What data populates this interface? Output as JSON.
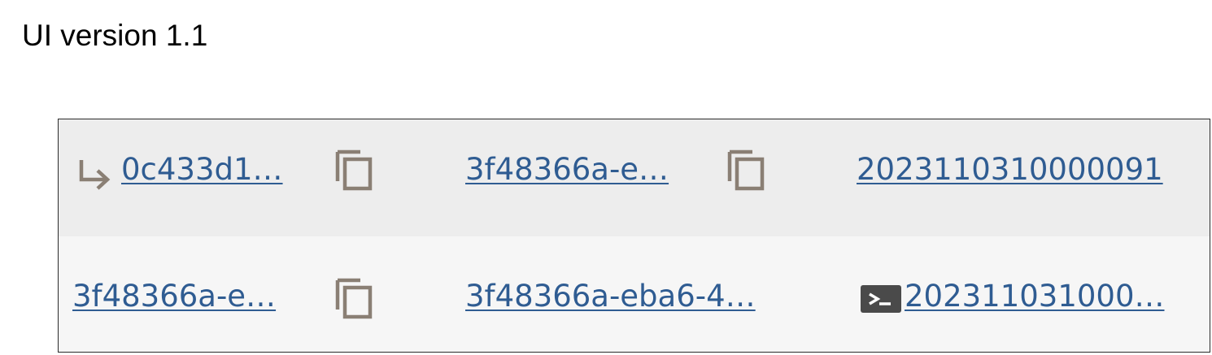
{
  "caption": "UI version 1.1",
  "rows": [
    {
      "col1": {
        "icon": "return-arrow-icon",
        "text": "0c433d1…",
        "copy_icon": "copy-icon"
      },
      "col2": {
        "text": "3f48366a-e…",
        "copy_icon": "copy-icon"
      },
      "col3": {
        "text": "2023110310000091"
      }
    },
    {
      "col1": {
        "text": "3f48366a-e…",
        "copy_icon": "copy-icon"
      },
      "col2": {
        "text": "3f48366a-eba6-4…"
      },
      "col3": {
        "icon": "terminal-icon",
        "text": "202311031000…"
      }
    }
  ],
  "colors": {
    "link": "#2f5c92",
    "icon": "#8a7f74",
    "row_alt_1": "#ededed",
    "row_alt_2": "#f6f6f6",
    "terminal_bg": "#4a4a4a"
  }
}
